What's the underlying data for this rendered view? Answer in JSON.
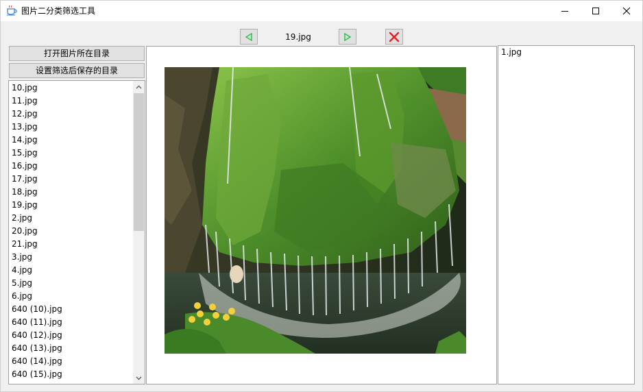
{
  "window": {
    "title": "图片二分类筛选工具",
    "app_icon": "coffee-cup-icon",
    "controls": [
      "minimize-icon",
      "maximize-icon",
      "close-icon"
    ]
  },
  "toolbar": {
    "prev_icon": "triangle-left-icon",
    "next_icon": "triangle-right-icon",
    "delete_icon": "red-x-icon",
    "current_file": "19.jpg",
    "accent_green": "#22b14c",
    "delete_red": "#ed1c24"
  },
  "left_panel": {
    "open_dir_label": "打开图片所在目录",
    "set_save_dir_label": "设置筛选后保存的目录",
    "files": [
      "10.jpg",
      "11.jpg",
      "12.jpg",
      "13.jpg",
      "14.jpg",
      "15.jpg",
      "16.jpg",
      "17.jpg",
      "18.jpg",
      "19.jpg",
      "2.jpg",
      "20.jpg",
      "21.jpg",
      "3.jpg",
      "4.jpg",
      "5.jpg",
      "6.jpg",
      "640 (10).jpg",
      "640 (11).jpg",
      "640 (12).jpg",
      "640 (13).jpg",
      "640 (14).jpg",
      "640 (15).jpg"
    ]
  },
  "preview": {
    "image_subject": "moss-covered rock waterfall with yellow flowers"
  },
  "right_panel": {
    "files": [
      "1.jpg"
    ]
  }
}
